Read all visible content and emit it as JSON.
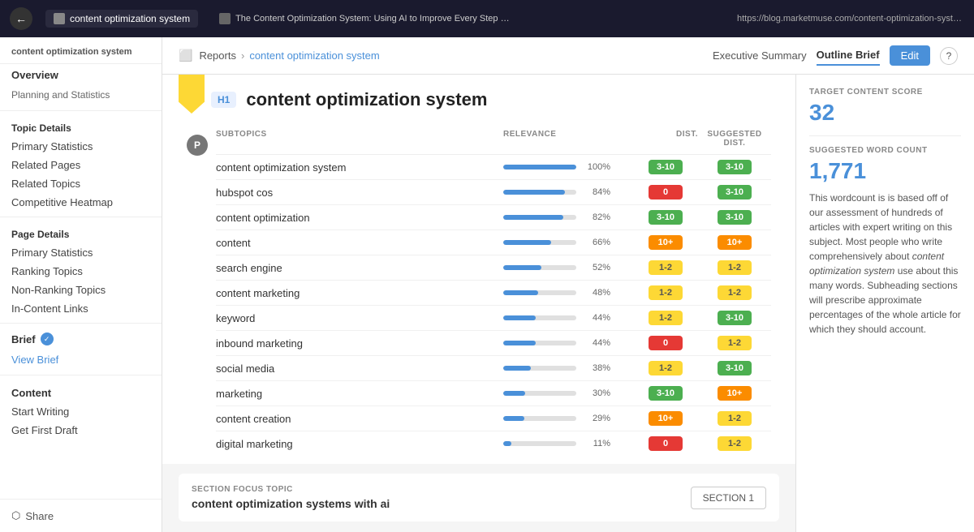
{
  "topbar": {
    "back_label": "←",
    "tab1_label": "content optimization system",
    "tab2_label": "The Content Optimization System: Using AI to Improve Every Step of Content Creation - MarketMuse",
    "url": "https://blog.marketmuse.com/content-optimization-system/"
  },
  "sidebar": {
    "logo": "content optimization system",
    "overview_label": "Overview",
    "planning_label": "Planning and Statistics",
    "topic_details_label": "Topic Details",
    "primary_stats_label": "Primary Statistics",
    "related_pages_label": "Related Pages",
    "related_topics_label": "Related Topics",
    "competitive_label": "Competitive Heatmap",
    "page_details_label": "Page Details",
    "page_primary_label": "Primary Statistics",
    "ranking_topics_label": "Ranking Topics",
    "non_ranking_label": "Non-Ranking Topics",
    "in_content_label": "In-Content Links",
    "brief_label": "Brief",
    "view_brief_label": "View Brief",
    "content_label": "Content",
    "start_writing_label": "Start Writing",
    "get_draft_label": "Get First Draft",
    "share_label": "Share"
  },
  "toolbar": {
    "reports_label": "Reports",
    "separator": "›",
    "current_label": "content optimization system",
    "executive_label": "Executive Summary",
    "outline_label": "Outline Brief",
    "edit_label": "Edit",
    "help_label": "?"
  },
  "article": {
    "h1_badge": "H1",
    "p_badge": "P",
    "title": "content optimization system",
    "col_subtopics": "SUBTOPICS",
    "col_relevance": "RELEVANCE",
    "col_dist": "DIST.",
    "col_suggested": "SUGGESTED DIST.",
    "rows": [
      {
        "topic": "content optimization system",
        "pct": 100,
        "bar": 100,
        "dist": "3-10",
        "dist_color": "green",
        "sugg": "3-10",
        "sugg_color": "green"
      },
      {
        "topic": "hubspot cos",
        "pct": 84,
        "bar": 84,
        "dist": "0",
        "dist_color": "red",
        "sugg": "3-10",
        "sugg_color": "green"
      },
      {
        "topic": "content optimization",
        "pct": 82,
        "bar": 82,
        "dist": "3-10",
        "dist_color": "green",
        "sugg": "3-10",
        "sugg_color": "green"
      },
      {
        "topic": "content",
        "pct": 66,
        "bar": 66,
        "dist": "10+",
        "dist_color": "orange",
        "sugg": "10+",
        "sugg_color": "orange"
      },
      {
        "topic": "search engine",
        "pct": 52,
        "bar": 52,
        "dist": "1-2",
        "dist_color": "yellow",
        "sugg": "1-2",
        "sugg_color": "yellow"
      },
      {
        "topic": "content marketing",
        "pct": 48,
        "bar": 48,
        "dist": "1-2",
        "dist_color": "yellow",
        "sugg": "1-2",
        "sugg_color": "yellow"
      },
      {
        "topic": "keyword",
        "pct": 44,
        "bar": 44,
        "dist": "1-2",
        "dist_color": "yellow",
        "sugg": "3-10",
        "sugg_color": "green"
      },
      {
        "topic": "inbound marketing",
        "pct": 44,
        "bar": 44,
        "dist": "0",
        "dist_color": "red",
        "sugg": "1-2",
        "sugg_color": "yellow"
      },
      {
        "topic": "social media",
        "pct": 38,
        "bar": 38,
        "dist": "1-2",
        "dist_color": "yellow",
        "sugg": "3-10",
        "sugg_color": "green"
      },
      {
        "topic": "marketing",
        "pct": 30,
        "bar": 30,
        "dist": "3-10",
        "dist_color": "green",
        "sugg": "10+",
        "sugg_color": "orange"
      },
      {
        "topic": "content creation",
        "pct": 29,
        "bar": 29,
        "dist": "10+",
        "dist_color": "orange",
        "sugg": "1-2",
        "sugg_color": "yellow"
      },
      {
        "topic": "digital marketing",
        "pct": 11,
        "bar": 11,
        "dist": "0",
        "dist_color": "red",
        "sugg": "1-2",
        "sugg_color": "yellow"
      }
    ]
  },
  "right_panel": {
    "target_score_label": "TARGET CONTENT SCORE",
    "target_score": "32",
    "word_count_label": "SUGGESTED WORD COUNT",
    "word_count": "1,771",
    "description": "This wordcount is is based off of our assessment of hundreds of articles with expert writing on this subject. Most people who write comprehensively about content optimization system use about this many words. Subheading sections will prescribe approximate percentages of the whole article for which they should account."
  },
  "section_focus": {
    "label": "SECTION FOCUS TOPIC",
    "topic": "content optimization systems with ai",
    "section_btn": "SECTION 1"
  }
}
